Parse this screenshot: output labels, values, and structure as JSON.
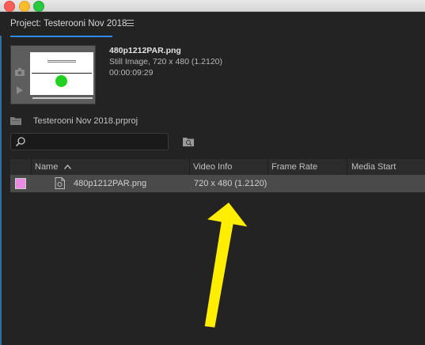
{
  "window": {
    "controls": [
      "close",
      "minimize",
      "zoom"
    ]
  },
  "panel": {
    "title": "Project: Testerooni Nov 2018",
    "menu_icon": "hamburger-icon"
  },
  "preview": {
    "file_name": "480p1212PAR.png",
    "type_line": "Still Image, 720 x 480 (1.2120)",
    "duration": "00:00:09:29"
  },
  "project": {
    "file_label": "Testerooni Nov 2018.prproj"
  },
  "search": {
    "value": "",
    "placeholder": ""
  },
  "table": {
    "columns": [
      "Name",
      "Video Info",
      "Frame Rate",
      "Media Start"
    ],
    "rows": [
      {
        "label_color": "#e98ae3",
        "name": "480p1212PAR.png",
        "video_info": "720 x 480 (1.2120)",
        "frame_rate": "",
        "media_start": ""
      }
    ]
  },
  "colors": {
    "panel_bg": "#232323",
    "accent_blue": "#2d8ceb",
    "selected_row": "#4a4a4a",
    "annotation_arrow": "#ffee00"
  }
}
